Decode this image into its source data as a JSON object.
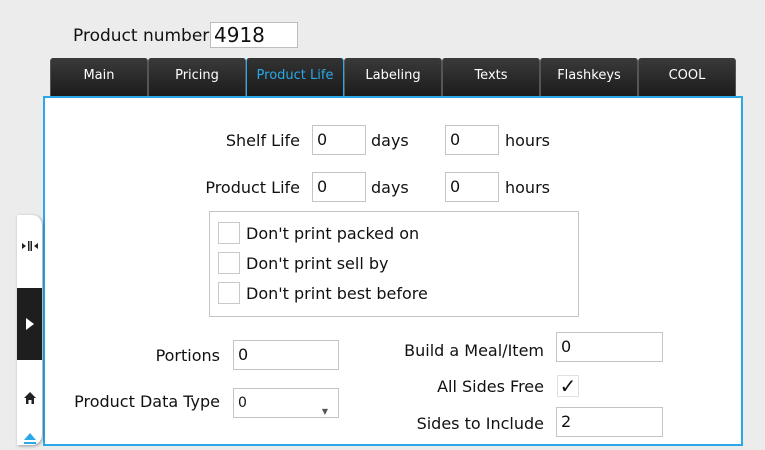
{
  "header": {
    "product_number_label": "Product number",
    "product_number_value": "4918"
  },
  "tabs": [
    {
      "label": "Main",
      "active": false
    },
    {
      "label": "Pricing",
      "active": false
    },
    {
      "label": "Product Life",
      "active": true
    },
    {
      "label": "Labeling",
      "active": false
    },
    {
      "label": "Texts",
      "active": false
    },
    {
      "label": "Flashkeys",
      "active": false
    },
    {
      "label": "COOL",
      "active": false
    }
  ],
  "product_life": {
    "shelf_life": {
      "label": "Shelf Life",
      "days": "0",
      "days_unit": "days",
      "hours": "0",
      "hours_unit": "hours"
    },
    "product_life": {
      "label": "Product Life",
      "days": "0",
      "days_unit": "days",
      "hours": "0",
      "hours_unit": "hours"
    },
    "print_options": [
      {
        "label": "Don't print packed on",
        "checked": false
      },
      {
        "label": "Don't print sell by",
        "checked": false
      },
      {
        "label": "Don't print best before",
        "checked": false
      }
    ],
    "portions": {
      "label": "Portions",
      "value": "0"
    },
    "product_data_type": {
      "label": "Product Data Type",
      "value": "0"
    },
    "build_a_meal": {
      "label": "Build a Meal/Item",
      "value": "0"
    },
    "all_sides_free": {
      "label": "All Sides Free",
      "checked": true,
      "mark": "✓"
    },
    "sides_to_include": {
      "label": "Sides to Include",
      "value": "2"
    }
  },
  "sidebar": {
    "icons": [
      "collapse-arrows-icon",
      "play-icon",
      "home-icon",
      "eject-icon"
    ]
  },
  "colors": {
    "accent": "#2aa9e6",
    "tab_bg": "#232323"
  }
}
